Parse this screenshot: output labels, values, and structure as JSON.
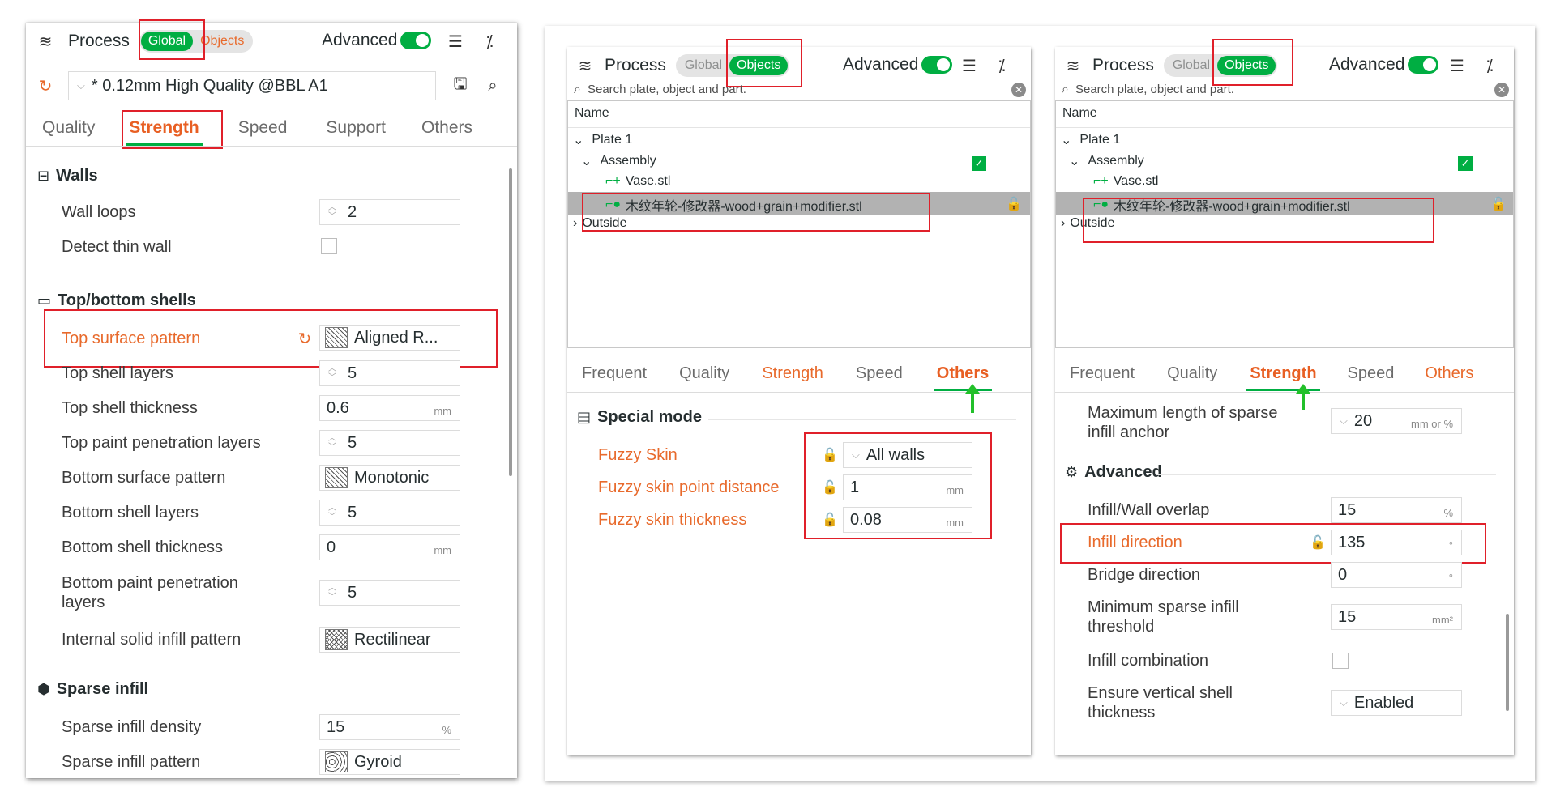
{
  "panel1": {
    "title": "Process",
    "seg_global": "Global",
    "seg_objects": "Objects",
    "advanced": "Advanced",
    "preset": "* 0.12mm High Quality @BBL A1",
    "tabs": [
      "Quality",
      "Strength",
      "Speed",
      "Support",
      "Others"
    ],
    "walls": {
      "title": "Walls",
      "wall_loops_label": "Wall loops",
      "wall_loops_value": "2",
      "detect_thin_label": "Detect thin wall"
    },
    "topbottom": {
      "title": "Top/bottom shells",
      "rows": [
        {
          "label": "Top surface pattern",
          "value": "Aligned R..."
        },
        {
          "label": "Top shell layers",
          "value": "5"
        },
        {
          "label": "Top shell thickness",
          "value": "0.6",
          "unit": "mm"
        },
        {
          "label": "Top paint penetration layers",
          "value": "5"
        },
        {
          "label": "Bottom surface pattern",
          "value": "Monotonic"
        },
        {
          "label": "Bottom shell layers",
          "value": "5"
        },
        {
          "label": "Bottom shell thickness",
          "value": "0",
          "unit": "mm"
        },
        {
          "label": "Bottom paint penetration\nlayers",
          "value": "5"
        },
        {
          "label": "Internal solid infill pattern",
          "value": "Rectilinear"
        }
      ]
    },
    "sparse": {
      "title": "Sparse infill",
      "density_label": "Sparse infill density",
      "density_value": "15",
      "density_unit": "%",
      "pattern_label": "Sparse infill pattern",
      "pattern_value": "Gyroid"
    }
  },
  "panel2": {
    "title": "Process",
    "seg_global": "Global",
    "seg_objects": "Objects",
    "advanced": "Advanced",
    "search_placeholder": "Search plate, object and part.",
    "tree_header": "Name",
    "tree": {
      "plate": "Plate 1",
      "assembly": "Assembly",
      "vase": "Vase.stl",
      "modifier": "木纹年轮-修改器-wood+grain+modifier.stl",
      "outside": "Outside"
    },
    "tabs": [
      "Frequent",
      "Quality",
      "Strength",
      "Speed",
      "Others"
    ],
    "special": {
      "title": "Special mode",
      "fuzzy_label": "Fuzzy Skin",
      "fuzzy_value": "All walls",
      "dist_label": "Fuzzy skin point distance",
      "dist_value": "1",
      "dist_unit": "mm",
      "thick_label": "Fuzzy skin thickness",
      "thick_value": "0.08",
      "thick_unit": "mm"
    }
  },
  "panel3": {
    "title": "Process",
    "seg_global": "Global",
    "seg_objects": "Objects",
    "advanced": "Advanced",
    "search_placeholder": "Search plate, object and part.",
    "tree_header": "Name",
    "tree": {
      "plate": "Plate 1",
      "assembly": "Assembly",
      "vase": "Vase.stl",
      "modifier": "木纹年轮-修改器-wood+grain+modifier.stl",
      "outside": "Outside"
    },
    "tabs": [
      "Frequent",
      "Quality",
      "Strength",
      "Speed",
      "Others"
    ],
    "anchor_label": "Maximum length of sparse\ninfill anchor",
    "anchor_value": "20",
    "anchor_unit": "mm or %",
    "advanced_section": "Advanced",
    "rows": [
      {
        "label": "Infill/Wall overlap",
        "value": "15",
        "unit": "%"
      },
      {
        "label": "Infill direction",
        "value": "135",
        "unit": "°"
      },
      {
        "label": "Bridge direction",
        "value": "0",
        "unit": "°"
      },
      {
        "label": "Minimum sparse infill\nthreshold",
        "value": "15",
        "unit": "mm²"
      },
      {
        "label": "Infill combination"
      },
      {
        "label": "Ensure vertical shell\nthickness",
        "value": "Enabled"
      }
    ]
  }
}
